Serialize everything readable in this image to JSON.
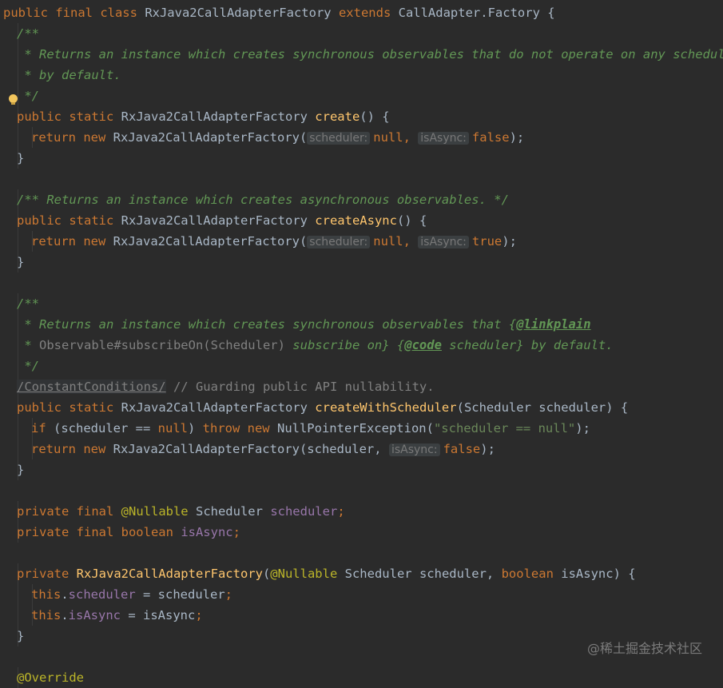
{
  "editor": {
    "lines": [
      {
        "indent": 0,
        "parts": [
          [
            "kw",
            "public final class "
          ],
          [
            "",
            "RxJava2CallAdapterFactory "
          ],
          [
            "kw",
            "extends "
          ],
          [
            "",
            "CallAdapter.Factory {"
          ]
        ]
      },
      {
        "indent": 1,
        "parts": [
          [
            "cm",
            "/**"
          ]
        ]
      },
      {
        "indent": 1,
        "parts": [
          [
            "cm",
            " * Returns an instance which creates synchronous observables that do not operate on any scheduler"
          ]
        ]
      },
      {
        "indent": 1,
        "parts": [
          [
            "cm",
            " * by default."
          ]
        ]
      },
      {
        "indent": 1,
        "parts": [
          [
            "cm",
            " */"
          ]
        ]
      },
      {
        "indent": 1,
        "parts": [
          [
            "kw",
            "public static "
          ],
          [
            "",
            "RxJava2CallAdapterFactory "
          ],
          [
            "fn",
            "create"
          ],
          [
            "",
            "() {"
          ]
        ]
      },
      {
        "indent": 2,
        "parts": [
          [
            "kw",
            "return new "
          ],
          [
            "",
            "RxJava2CallAdapterFactory("
          ],
          [
            "hint",
            "scheduler:"
          ],
          [
            "kw",
            "null, "
          ],
          [
            "hint",
            "isAsync:"
          ],
          [
            "kw",
            "false"
          ],
          [
            "",
            ");"
          ]
        ]
      },
      {
        "indent": 1,
        "parts": [
          [
            "",
            "}"
          ]
        ]
      },
      {
        "indent": 0,
        "parts": []
      },
      {
        "indent": 1,
        "parts": [
          [
            "cm",
            "/** Returns an instance which creates asynchronous observables. */"
          ]
        ]
      },
      {
        "indent": 1,
        "parts": [
          [
            "kw",
            "public static "
          ],
          [
            "",
            "RxJava2CallAdapterFactory "
          ],
          [
            "fn",
            "createAsync"
          ],
          [
            "",
            "() {"
          ]
        ]
      },
      {
        "indent": 2,
        "parts": [
          [
            "kw",
            "return new "
          ],
          [
            "",
            "RxJava2CallAdapterFactory("
          ],
          [
            "hint",
            "scheduler:"
          ],
          [
            "kw",
            "null, "
          ],
          [
            "hint",
            "isAsync:"
          ],
          [
            "kw",
            "true"
          ],
          [
            "",
            ");"
          ]
        ]
      },
      {
        "indent": 1,
        "parts": [
          [
            "",
            "}"
          ]
        ]
      },
      {
        "indent": 0,
        "parts": []
      },
      {
        "indent": 1,
        "parts": [
          [
            "cm",
            "/**"
          ]
        ]
      },
      {
        "indent": 1,
        "parts": [
          [
            "cm",
            " * Returns an instance which creates synchronous observables that {"
          ],
          [
            "tag",
            "@linkplain"
          ]
        ]
      },
      {
        "indent": 1,
        "parts": [
          [
            "cm",
            " * "
          ],
          [
            "cmp",
            "Observable#subscribeOn(Scheduler)"
          ],
          [
            "cm",
            " subscribe on} {"
          ],
          [
            "tag",
            "@code"
          ],
          [
            "cm",
            " scheduler} by default."
          ]
        ]
      },
      {
        "indent": 1,
        "parts": [
          [
            "cm",
            " */"
          ]
        ]
      },
      {
        "indent": 1,
        "parts": [
          [
            "suppress",
            "/ConstantConditions/"
          ],
          [
            "cmp",
            " // Guarding public API nullability."
          ]
        ]
      },
      {
        "indent": 1,
        "parts": [
          [
            "kw",
            "public static "
          ],
          [
            "",
            "RxJava2CallAdapterFactory "
          ],
          [
            "fn",
            "createWithScheduler"
          ],
          [
            "",
            "(Scheduler scheduler) {"
          ]
        ]
      },
      {
        "indent": 2,
        "parts": [
          [
            "kw",
            "if "
          ],
          [
            "",
            "(scheduler == "
          ],
          [
            "kw",
            "null"
          ],
          [
            "",
            ") "
          ],
          [
            "kw",
            "throw new "
          ],
          [
            "",
            "NullPointerException("
          ],
          [
            "str",
            "\"scheduler == null\""
          ],
          [
            "",
            ");"
          ]
        ]
      },
      {
        "indent": 2,
        "parts": [
          [
            "kw",
            "return new "
          ],
          [
            "",
            "RxJava2CallAdapterFactory(scheduler, "
          ],
          [
            "hint",
            "isAsync:"
          ],
          [
            "kw",
            "false"
          ],
          [
            "",
            ");"
          ]
        ]
      },
      {
        "indent": 1,
        "parts": [
          [
            "",
            "}"
          ]
        ]
      },
      {
        "indent": 0,
        "parts": []
      },
      {
        "indent": 1,
        "parts": [
          [
            "kw",
            "private final "
          ],
          [
            "ann",
            "@Nullable "
          ],
          [
            "",
            "Scheduler "
          ],
          [
            "fld",
            "scheduler"
          ],
          [
            "kw",
            ";"
          ]
        ]
      },
      {
        "indent": 1,
        "parts": [
          [
            "kw",
            "private final boolean "
          ],
          [
            "fld",
            "isAsync"
          ],
          [
            "kw",
            ";"
          ]
        ]
      },
      {
        "indent": 0,
        "parts": []
      },
      {
        "indent": 1,
        "parts": [
          [
            "kw",
            "private "
          ],
          [
            "fn",
            "RxJava2CallAdapterFactory"
          ],
          [
            "",
            "("
          ],
          [
            "ann",
            "@Nullable "
          ],
          [
            "",
            "Scheduler scheduler, "
          ],
          [
            "kw",
            "boolean "
          ],
          [
            "",
            "isAsync) {"
          ]
        ]
      },
      {
        "indent": 2,
        "parts": [
          [
            "kw",
            "this"
          ],
          [
            "",
            "."
          ],
          [
            "fld",
            "scheduler"
          ],
          [
            "",
            " = scheduler"
          ],
          [
            "kw",
            ";"
          ]
        ]
      },
      {
        "indent": 2,
        "parts": [
          [
            "kw",
            "this"
          ],
          [
            "",
            "."
          ],
          [
            "fld",
            "isAsync"
          ],
          [
            "",
            " = isAsync"
          ],
          [
            "kw",
            ";"
          ]
        ]
      },
      {
        "indent": 1,
        "parts": [
          [
            "",
            "}"
          ]
        ]
      },
      {
        "indent": 0,
        "parts": []
      },
      {
        "indent": 1,
        "parts": [
          [
            "ann",
            "@Override"
          ]
        ]
      }
    ]
  },
  "watermark": {
    "text": "@稀土掘金技术社区"
  },
  "colors": {
    "background": "#2b2b2b",
    "keyword": "#cc7832",
    "function": "#ffc66d",
    "comment": "#629755",
    "string": "#6a8759",
    "field": "#9876aa",
    "annotation": "#bbb529"
  },
  "icons": {
    "gutter_hint": "lightbulb-icon"
  }
}
